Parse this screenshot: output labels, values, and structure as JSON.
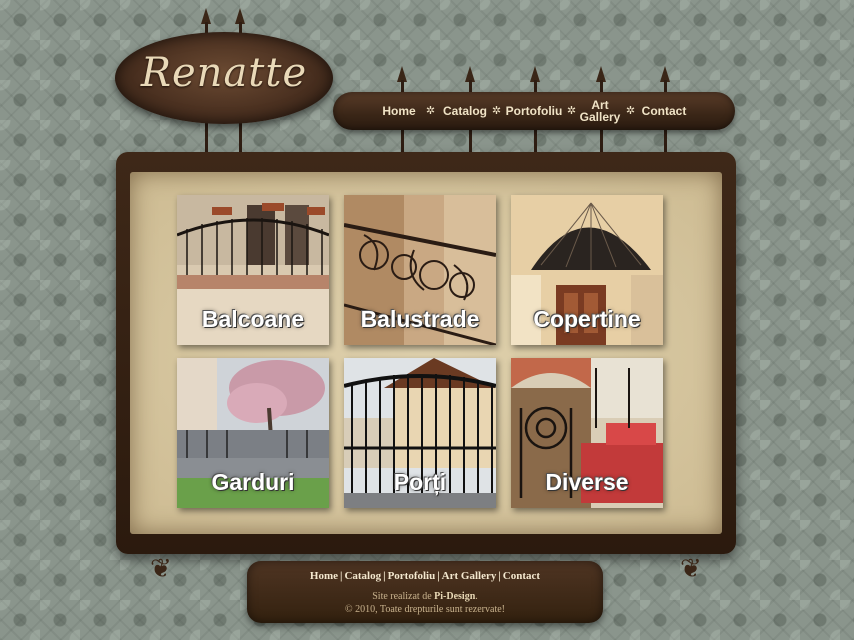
{
  "logo": {
    "text": "Renatte"
  },
  "nav": {
    "items": [
      {
        "label": "Home"
      },
      {
        "label": "Catalog"
      },
      {
        "label": "Portofoliu"
      },
      {
        "label": "Art Gallery"
      },
      {
        "label": "Contact"
      }
    ],
    "separator": "✲"
  },
  "categories": [
    {
      "label": "Balcoane"
    },
    {
      "label": "Balustrade"
    },
    {
      "label": "Copertine"
    },
    {
      "label": "Garduri"
    },
    {
      "label": "Porți"
    },
    {
      "label": "Diverse"
    }
  ],
  "footer": {
    "links": [
      "Home",
      "Catalog",
      "Portofoliu",
      "Art Gallery",
      "Contact"
    ],
    "separator": "|",
    "credit_prefix": "Site realizat de",
    "credit_name": "Pi-Design",
    "credit_suffix": ".",
    "copyright": "© 2010, Toate drepturile sunt rezervate!"
  }
}
